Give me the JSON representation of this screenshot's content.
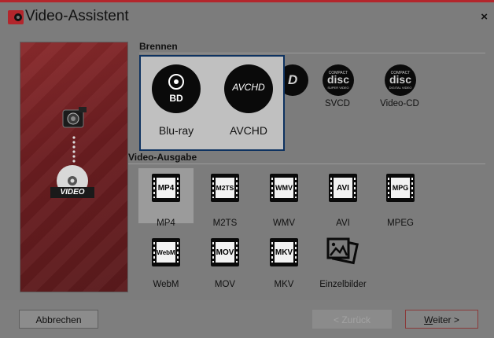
{
  "window": {
    "title": "Video-Assistent",
    "close_symbol": "×"
  },
  "sections": {
    "burn": "Brennen",
    "video_output": "Video-Ausgabe"
  },
  "disc_tiles": [
    {
      "label": "DVD",
      "visible_label": "D"
    },
    {
      "label": "SVCD",
      "logo_top": "COMPACT",
      "logo_main": "disc",
      "logo_bottom": "SUPER VIDEO"
    },
    {
      "label": "Video-CD",
      "logo_top": "COMPACT",
      "logo_main": "disc",
      "logo_bottom": "DIGITAL VIDEO"
    }
  ],
  "popup": {
    "items": [
      {
        "label": "Blu-ray",
        "icon_text": "BD"
      },
      {
        "label": "AVCHD",
        "icon_text": "AVCHD"
      }
    ]
  },
  "video_formats": [
    {
      "icon_text": "MP4",
      "label": "MP4",
      "selected": true
    },
    {
      "icon_text": "M2TS",
      "label": "M2TS"
    },
    {
      "icon_text": "WMV",
      "label": "WMV"
    },
    {
      "icon_text": "AVI",
      "label": "AVI"
    },
    {
      "icon_text": "MPG",
      "label": "MPEG"
    },
    {
      "icon_text": "WebM",
      "label": "WebM"
    },
    {
      "icon_text": "MOV",
      "label": "MOV"
    },
    {
      "icon_text": "MKV",
      "label": "MKV"
    },
    {
      "icon_text": "",
      "label": "Einzelbilder",
      "icon": "images-icon"
    }
  ],
  "sidebar": {
    "badge": "VIDEO"
  },
  "buttons": {
    "cancel": "Abbrechen",
    "back": "< Zurück",
    "next_underlined": "W",
    "next_rest": "eiter >"
  },
  "colors": {
    "accent": "#b3262c",
    "popup_border": "#0e3260"
  }
}
